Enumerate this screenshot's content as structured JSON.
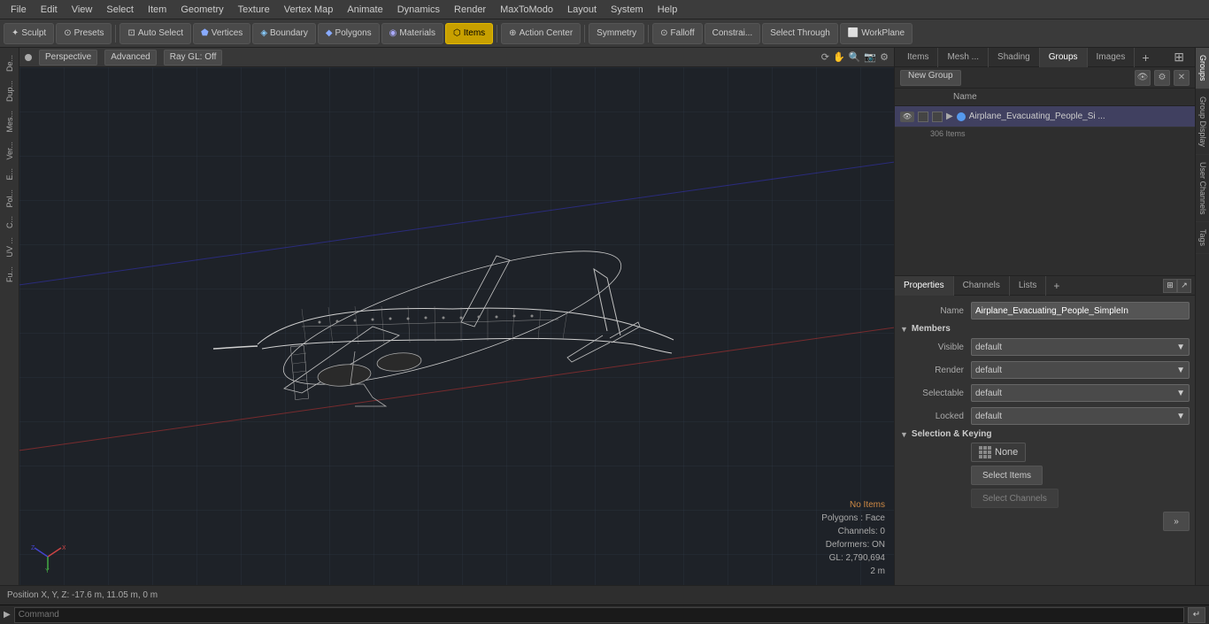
{
  "menu": {
    "items": [
      "File",
      "Edit",
      "View",
      "Select",
      "Item",
      "Geometry",
      "Texture",
      "Vertex Map",
      "Animate",
      "Dynamics",
      "Render",
      "MaxToModo",
      "Layout",
      "System",
      "Help"
    ]
  },
  "toolbar": {
    "sculpt_label": "Sculpt",
    "presets_label": "Presets",
    "auto_select_label": "Auto Select",
    "vertices_label": "Vertices",
    "boundary_label": "Boundary",
    "polygons_label": "Polygons",
    "materials_label": "Materials",
    "items_label": "Items",
    "action_center_label": "Action Center",
    "symmetry_label": "Symmetry",
    "falloff_label": "Falloff",
    "constraints_label": "Constrai...",
    "select_through_label": "Select Through",
    "workplane_label": "WorkPlane"
  },
  "viewport": {
    "mode": "Perspective",
    "advanced_label": "Advanced",
    "raygl_label": "Ray GL: Off",
    "no_items": "No Items",
    "polygons_face": "Polygons : Face",
    "channels": "Channels: 0",
    "deformers": "Deformers: ON",
    "gl_count": "GL: 2,790,694",
    "units": "2 m"
  },
  "right_panel": {
    "tabs": [
      "Items",
      "Mesh ...",
      "Shading",
      "Groups",
      "Images"
    ],
    "active_tab": "Groups",
    "add_tab_icon": "+",
    "expand_icon": "⊞"
  },
  "groups": {
    "new_group_label": "New Group",
    "col_name_label": "Name",
    "items": [
      {
        "name": "Airplane_Evacuating_People_Si ...",
        "count": "306 Items",
        "color": "#5599ee"
      }
    ]
  },
  "properties": {
    "tabs": [
      "Properties",
      "Channels",
      "Lists"
    ],
    "add_tab_icon": "+",
    "name_label": "Name",
    "name_value": "Airplane_Evacuating_People_SimpleIn",
    "members_label": "Members",
    "visible_label": "Visible",
    "visible_value": "default",
    "render_label": "Render",
    "render_value": "default",
    "selectable_label": "Selectable",
    "selectable_value": "default",
    "locked_label": "Locked",
    "locked_value": "default",
    "selection_keying_label": "Selection & Keying",
    "none_label": "None",
    "select_items_label": "Select Items",
    "select_channels_label": "Select Channels"
  },
  "far_right_tabs": [
    "Groups",
    "Group Display",
    "User Channels",
    "Tags"
  ],
  "status_bar": {
    "position_label": "Position X, Y, Z:",
    "position_value": "-17.6 m, 11.05 m, 0 m"
  },
  "command_bar": {
    "arrow": "▶",
    "placeholder": "Command",
    "enter_icon": "↵"
  },
  "left_sidebar": {
    "tabs": [
      "De...",
      "Dup...",
      "Mes...",
      "Ver...",
      "E...",
      "Pol...",
      "C...",
      "UV ...",
      "Fu..."
    ]
  }
}
